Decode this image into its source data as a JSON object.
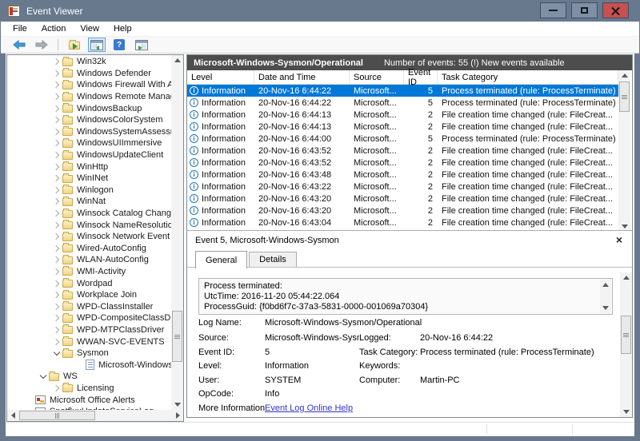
{
  "window": {
    "title": "Event Viewer"
  },
  "menu": {
    "items": [
      "File",
      "Action",
      "View",
      "Help"
    ]
  },
  "toolbar": {
    "buttons": [
      {
        "name": "back"
      },
      {
        "name": "forward"
      },
      {
        "name": "export"
      },
      {
        "name": "console-tree",
        "active": true
      },
      {
        "name": "help"
      },
      {
        "name": "action-pane"
      }
    ]
  },
  "tree": {
    "items": [
      {
        "label": "Win32k",
        "depth": 3,
        "state": "collapsed",
        "icon": "folder"
      },
      {
        "label": "Windows Defender",
        "depth": 3,
        "state": "collapsed",
        "icon": "folder"
      },
      {
        "label": "Windows Firewall With Adv",
        "depth": 3,
        "state": "collapsed",
        "icon": "folder"
      },
      {
        "label": "Windows Remote Manager",
        "depth": 3,
        "state": "collapsed",
        "icon": "folder"
      },
      {
        "label": "WindowsBackup",
        "depth": 3,
        "state": "collapsed",
        "icon": "folder"
      },
      {
        "label": "WindowsColorSystem",
        "depth": 3,
        "state": "collapsed",
        "icon": "folder"
      },
      {
        "label": "WindowsSystemAssessmen",
        "depth": 3,
        "state": "collapsed",
        "icon": "folder"
      },
      {
        "label": "WindowsUIImmersive",
        "depth": 3,
        "state": "collapsed",
        "icon": "folder"
      },
      {
        "label": "WindowsUpdateClient",
        "depth": 3,
        "state": "collapsed",
        "icon": "folder"
      },
      {
        "label": "WinHttp",
        "depth": 3,
        "state": "collapsed",
        "icon": "folder"
      },
      {
        "label": "WinINet",
        "depth": 3,
        "state": "collapsed",
        "icon": "folder"
      },
      {
        "label": "Winlogon",
        "depth": 3,
        "state": "collapsed",
        "icon": "folder"
      },
      {
        "label": "WinNat",
        "depth": 3,
        "state": "collapsed",
        "icon": "folder"
      },
      {
        "label": "Winsock Catalog Change",
        "depth": 3,
        "state": "collapsed",
        "icon": "folder"
      },
      {
        "label": "Winsock NameResolution E",
        "depth": 3,
        "state": "collapsed",
        "icon": "folder"
      },
      {
        "label": "Winsock Network Event",
        "depth": 3,
        "state": "collapsed",
        "icon": "folder"
      },
      {
        "label": "Wired-AutoConfig",
        "depth": 3,
        "state": "collapsed",
        "icon": "folder"
      },
      {
        "label": "WLAN-AutoConfig",
        "depth": 3,
        "state": "collapsed",
        "icon": "folder"
      },
      {
        "label": "WMI-Activity",
        "depth": 3,
        "state": "collapsed",
        "icon": "folder"
      },
      {
        "label": "Wordpad",
        "depth": 3,
        "state": "collapsed",
        "icon": "folder"
      },
      {
        "label": "Workplace Join",
        "depth": 3,
        "state": "collapsed",
        "icon": "folder"
      },
      {
        "label": "WPD-ClassInstaller",
        "depth": 3,
        "state": "collapsed",
        "icon": "folder"
      },
      {
        "label": "WPD-CompositeClassDrive",
        "depth": 3,
        "state": "collapsed",
        "icon": "folder"
      },
      {
        "label": "WPD-MTPClassDriver",
        "depth": 3,
        "state": "collapsed",
        "icon": "folder"
      },
      {
        "label": "WWAN-SVC-EVENTS",
        "depth": 3,
        "state": "collapsed",
        "icon": "folder"
      },
      {
        "label": "Sysmon",
        "depth": 3,
        "state": "expanded",
        "icon": "folder"
      },
      {
        "label": "Microsoft-Windows-Sys",
        "depth": 4,
        "state": "none",
        "icon": "log"
      },
      {
        "label": "WS",
        "depth": 2,
        "state": "expanded",
        "icon": "folder"
      },
      {
        "label": "Licensing",
        "depth": 3,
        "state": "collapsed",
        "icon": "folder"
      },
      {
        "label": "Microsoft Office Alerts",
        "depth": 1,
        "state": "none",
        "icon": "eventlog"
      },
      {
        "label": "SpotfluxUpdateServiceLog",
        "depth": 1,
        "state": "none",
        "icon": "eventlog"
      }
    ]
  },
  "main": {
    "header": {
      "title": "Microsoft-Windows-Sysmon/Operational",
      "summary": "Number of events: 55 (!) New events available"
    }
  },
  "table": {
    "columns": [
      "Level",
      "Date and Time",
      "Source",
      "Event ID",
      "Task Category"
    ],
    "rows": [
      {
        "level": "Information",
        "datetime": "20-Nov-16 6:44:22",
        "source": "Microsoft...",
        "event_id": "5",
        "category": "Process terminated (rule: ProcessTerminate)",
        "selected": true
      },
      {
        "level": "Information",
        "datetime": "20-Nov-16 6:44:22",
        "source": "Microsoft...",
        "event_id": "5",
        "category": "Process terminated (rule: ProcessTerminate)",
        "selected": false
      },
      {
        "level": "Information",
        "datetime": "20-Nov-16 6:44:13",
        "source": "Microsoft...",
        "event_id": "2",
        "category": "File creation time changed (rule: FileCreat...",
        "selected": false
      },
      {
        "level": "Information",
        "datetime": "20-Nov-16 6:44:13",
        "source": "Microsoft...",
        "event_id": "2",
        "category": "File creation time changed (rule: FileCreat...",
        "selected": false
      },
      {
        "level": "Information",
        "datetime": "20-Nov-16 6:44:00",
        "source": "Microsoft...",
        "event_id": "5",
        "category": "Process terminated (rule: ProcessTerminate)",
        "selected": false
      },
      {
        "level": "Information",
        "datetime": "20-Nov-16 6:43:52",
        "source": "Microsoft...",
        "event_id": "2",
        "category": "File creation time changed (rule: FileCreat...",
        "selected": false
      },
      {
        "level": "Information",
        "datetime": "20-Nov-16 6:43:52",
        "source": "Microsoft...",
        "event_id": "2",
        "category": "File creation time changed (rule: FileCreat...",
        "selected": false
      },
      {
        "level": "Information",
        "datetime": "20-Nov-16 6:43:48",
        "source": "Microsoft...",
        "event_id": "2",
        "category": "File creation time changed (rule: FileCreat...",
        "selected": false
      },
      {
        "level": "Information",
        "datetime": "20-Nov-16 6:43:22",
        "source": "Microsoft...",
        "event_id": "2",
        "category": "File creation time changed (rule: FileCreat...",
        "selected": false
      },
      {
        "level": "Information",
        "datetime": "20-Nov-16 6:43:20",
        "source": "Microsoft...",
        "event_id": "2",
        "category": "File creation time changed (rule: FileCreat...",
        "selected": false
      },
      {
        "level": "Information",
        "datetime": "20-Nov-16 6:43:20",
        "source": "Microsoft...",
        "event_id": "2",
        "category": "File creation time changed (rule: FileCreat...",
        "selected": false
      },
      {
        "level": "Information",
        "datetime": "20-Nov-16 6:43:04",
        "source": "Microsoft...",
        "event_id": "2",
        "category": "File creation time changed (rule: FileCreat...",
        "selected": false
      }
    ]
  },
  "preview": {
    "header": "Event 5, Microsoft-Windows-Sysmon",
    "tabs": [
      {
        "label": "General",
        "active": true
      },
      {
        "label": "Details",
        "active": false
      }
    ],
    "message_lines": [
      "Process terminated:",
      "UtcTime: 2016-11-20 05:44:22.064",
      "ProcessGuid: {f0bd6f7c-37a3-5831-0000-001069a70304}"
    ],
    "fields": [
      {
        "label": "Log Name:",
        "value": "Microsoft-Windows-Sysmon/Operational",
        "label2": "",
        "value2": "",
        "wide": true
      },
      {
        "label": "Source:",
        "value": "Microsoft-Windows-Sysmon",
        "label2": "Logged:",
        "value2": "20-Nov-16 6:44:22"
      },
      {
        "label": "Event ID:",
        "value": "5",
        "label2": "Task Category:",
        "value2": "Process terminated (rule: ProcessTerminate)"
      },
      {
        "label": "Level:",
        "value": "Information",
        "label2": "Keywords:",
        "value2": ""
      },
      {
        "label": "User:",
        "value": "SYSTEM",
        "label2": "Computer:",
        "value2": "Martin-PC"
      },
      {
        "label": "OpCode:",
        "value": "Info",
        "label2": "",
        "value2": ""
      },
      {
        "label": "More Information:",
        "value": "Event Log Online Help",
        "link": true,
        "label2": "",
        "value2": ""
      }
    ]
  }
}
